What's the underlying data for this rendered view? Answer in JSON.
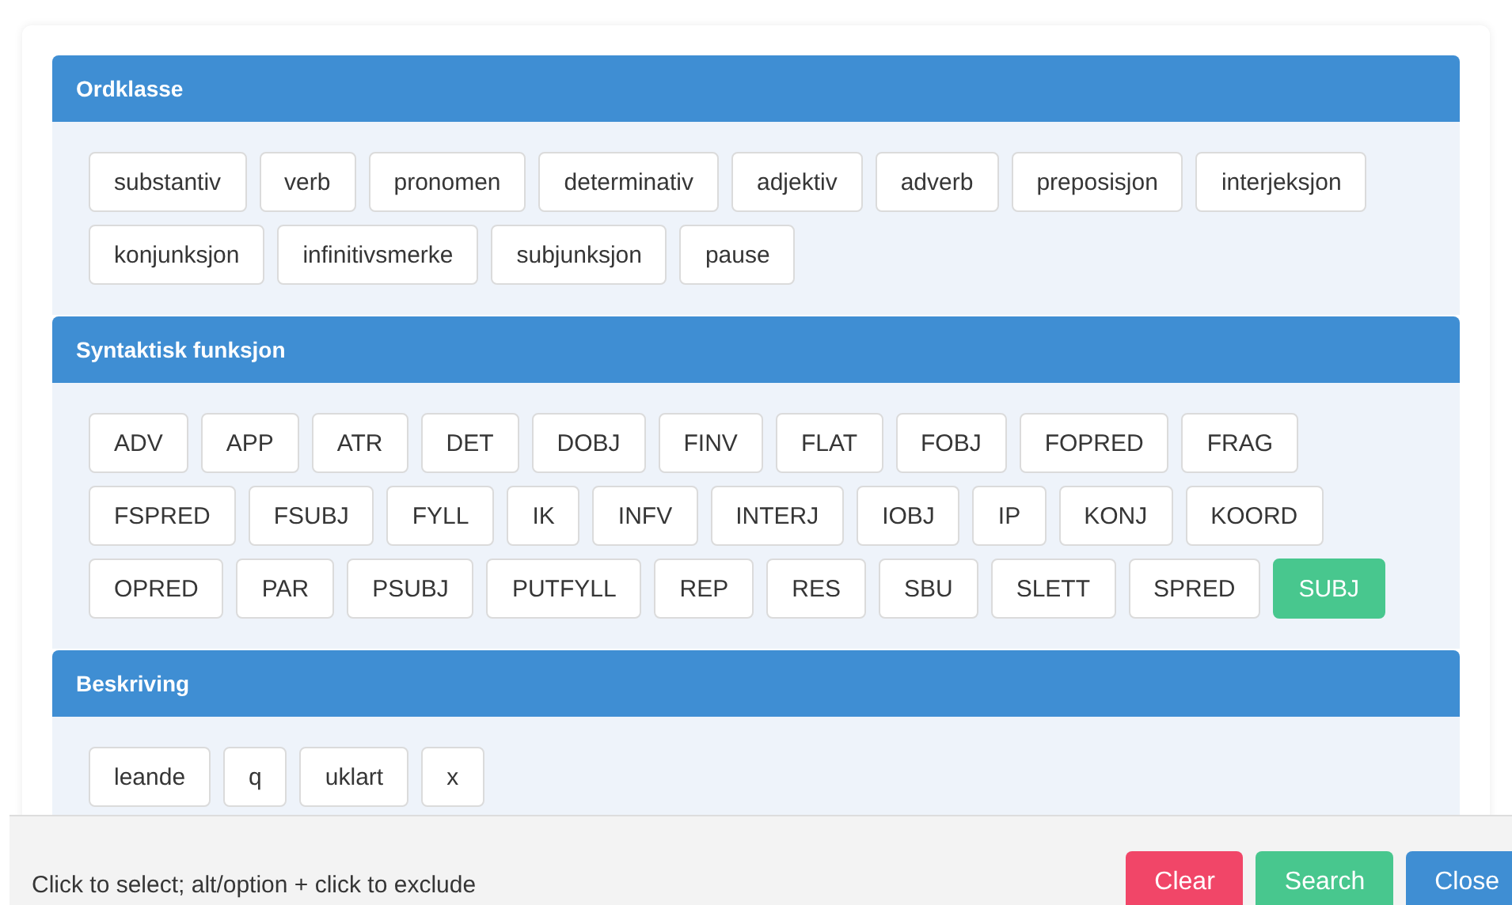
{
  "sections": [
    {
      "title": "Ordklasse",
      "tags": [
        {
          "label": "substantiv",
          "selected": false
        },
        {
          "label": "verb",
          "selected": false
        },
        {
          "label": "pronomen",
          "selected": false
        },
        {
          "label": "determinativ",
          "selected": false
        },
        {
          "label": "adjektiv",
          "selected": false
        },
        {
          "label": "adverb",
          "selected": false
        },
        {
          "label": "preposisjon",
          "selected": false
        },
        {
          "label": "interjeksjon",
          "selected": false
        },
        {
          "label": "konjunksjon",
          "selected": false
        },
        {
          "label": "infinitivsmerke",
          "selected": false
        },
        {
          "label": "subjunksjon",
          "selected": false
        },
        {
          "label": "pause",
          "selected": false
        }
      ]
    },
    {
      "title": "Syntaktisk funksjon",
      "tags": [
        {
          "label": "ADV",
          "selected": false
        },
        {
          "label": "APP",
          "selected": false
        },
        {
          "label": "ATR",
          "selected": false
        },
        {
          "label": "DET",
          "selected": false
        },
        {
          "label": "DOBJ",
          "selected": false
        },
        {
          "label": "FINV",
          "selected": false
        },
        {
          "label": "FLAT",
          "selected": false
        },
        {
          "label": "FOBJ",
          "selected": false
        },
        {
          "label": "FOPRED",
          "selected": false
        },
        {
          "label": "FRAG",
          "selected": false
        },
        {
          "label": "FSPRED",
          "selected": false
        },
        {
          "label": "FSUBJ",
          "selected": false
        },
        {
          "label": "FYLL",
          "selected": false
        },
        {
          "label": "IK",
          "selected": false
        },
        {
          "label": "INFV",
          "selected": false
        },
        {
          "label": "INTERJ",
          "selected": false
        },
        {
          "label": "IOBJ",
          "selected": false
        },
        {
          "label": "IP",
          "selected": false
        },
        {
          "label": "KONJ",
          "selected": false
        },
        {
          "label": "KOORD",
          "selected": false
        },
        {
          "label": "OPRED",
          "selected": false
        },
        {
          "label": "PAR",
          "selected": false
        },
        {
          "label": "PSUBJ",
          "selected": false
        },
        {
          "label": "PUTFYLL",
          "selected": false
        },
        {
          "label": "REP",
          "selected": false
        },
        {
          "label": "RES",
          "selected": false
        },
        {
          "label": "SBU",
          "selected": false
        },
        {
          "label": "SLETT",
          "selected": false
        },
        {
          "label": "SPRED",
          "selected": false
        },
        {
          "label": "SUBJ",
          "selected": true
        }
      ]
    },
    {
      "title": "Beskriving",
      "tags": [
        {
          "label": "leande",
          "selected": false
        },
        {
          "label": "q",
          "selected": false
        },
        {
          "label": "uklart",
          "selected": false
        },
        {
          "label": "x",
          "selected": false
        }
      ]
    }
  ],
  "footer": {
    "hint": "Click to select; alt/option + click to exclude",
    "buttons": [
      {
        "label": "Clear",
        "kind": "danger"
      },
      {
        "label": "Search",
        "kind": "success"
      },
      {
        "label": "Close",
        "kind": "primary"
      }
    ]
  }
}
